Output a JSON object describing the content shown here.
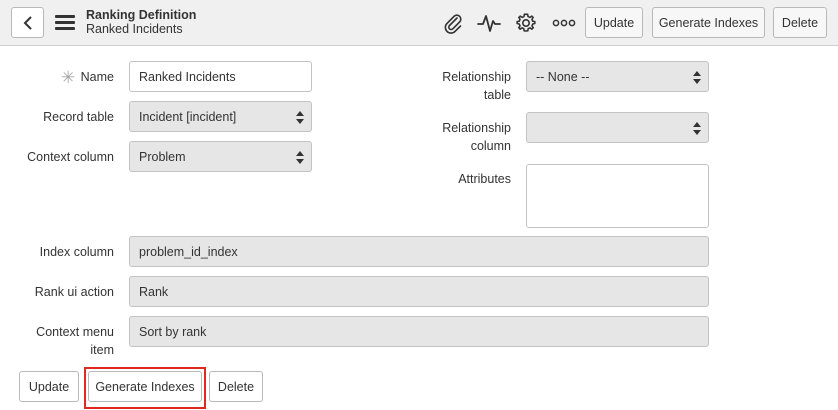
{
  "header": {
    "title": "Ranking Definition",
    "subtitle": "Ranked Incidents",
    "icons": [
      "back-icon",
      "menu-icon",
      "paperclip-icon",
      "activity-icon",
      "gear-icon",
      "more-icon"
    ],
    "buttons": {
      "update": "Update",
      "generate": "Generate Indexes",
      "delete": "Delete"
    }
  },
  "form": {
    "name": {
      "label": "Name",
      "value": "Ranked Incidents",
      "required_mark": "✳"
    },
    "record_table": {
      "label": "Record table",
      "value": "Incident [incident]"
    },
    "context_column": {
      "label": "Context column",
      "value": "Problem"
    },
    "relationship_table": {
      "label_line1": "Relationship",
      "label_line2": "table",
      "value": "-- None --"
    },
    "relationship_column": {
      "label_line1": "Relationship",
      "label_line2": "column",
      "value": ""
    },
    "attributes": {
      "label": "Attributes",
      "value": ""
    },
    "index_column": {
      "label": "Index column",
      "value": "problem_id_index"
    },
    "rank_ui_action": {
      "label": "Rank ui action",
      "value": "Rank"
    },
    "context_menu_item": {
      "label_line1": "Context menu",
      "label_line2": "item",
      "value": "Sort by rank"
    }
  },
  "footer": {
    "buttons": {
      "update": "Update",
      "generate": "Generate Indexes",
      "delete": "Delete"
    }
  },
  "colors": {
    "highlight": "#e0281d",
    "header_bg": "#f0f0f0",
    "readonly_field": "#e6e6e6"
  }
}
